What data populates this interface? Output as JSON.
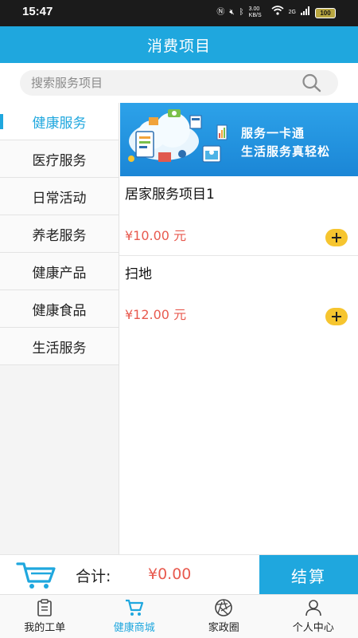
{
  "status_bar": {
    "time": "15:47",
    "net_speed": "3.00 KB/S",
    "signal": "2G",
    "battery": "100"
  },
  "header": {
    "title": "消费项目"
  },
  "search": {
    "placeholder": "搜索服务项目"
  },
  "sidebar": {
    "active_index": 0,
    "items": [
      {
        "label": "健康服务"
      },
      {
        "label": "医疗服务"
      },
      {
        "label": "日常活动"
      },
      {
        "label": "养老服务"
      },
      {
        "label": "健康产品"
      },
      {
        "label": "健康食品"
      },
      {
        "label": "生活服务"
      }
    ]
  },
  "banner": {
    "line1": "服务一卡通",
    "line2": "生活服务真轻松"
  },
  "products": [
    {
      "name": "居家服务项目1",
      "price": "¥10.00 元"
    },
    {
      "name": "扫地",
      "price": "¥12.00 元"
    }
  ],
  "cart": {
    "total_label": "合计:",
    "total_value": "¥0.00",
    "checkout_label": "结算"
  },
  "bottom_nav": {
    "active_index": 1,
    "items": [
      {
        "label": "我的工单",
        "icon": "clipboard-icon"
      },
      {
        "label": "健康商城",
        "icon": "cart-icon"
      },
      {
        "label": "家政圈",
        "icon": "aperture-icon"
      },
      {
        "label": "个人中心",
        "icon": "person-icon"
      }
    ]
  },
  "colors": {
    "primary": "#1fa7de",
    "price": "#e85a4f",
    "add_button": "#f6c52f",
    "status_bar": "#1b1b1b"
  }
}
